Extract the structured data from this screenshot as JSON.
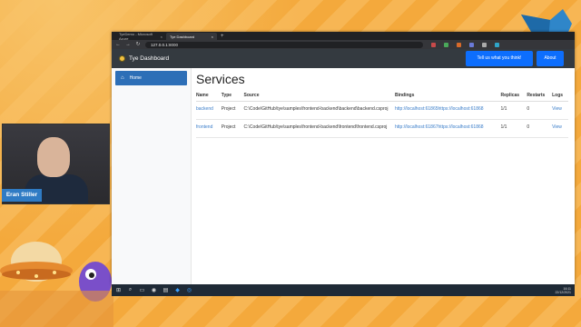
{
  "stream": {
    "presenter_name": "Eran Stiller"
  },
  "browser": {
    "tabs": [
      {
        "label": "TyeDemo - Microsoft Azure"
      },
      {
        "label": "Tye Dashboard"
      }
    ],
    "new_tab": "+",
    "address": {
      "host": "127.0.0.1",
      "port": ":8000"
    }
  },
  "app": {
    "brand": "Tye Dashboard",
    "feedback_button": "Tell us what you think!",
    "about_button": "About",
    "sidebar": [
      {
        "label": "Home"
      }
    ],
    "page_title": "Services",
    "table": {
      "headers": [
        "Name",
        "Type",
        "Source",
        "Bindings",
        "Replicas",
        "Restarts",
        "Logs"
      ],
      "rows": [
        {
          "name": "backend",
          "type": "Project",
          "source": "C:\\Code\\GitHub\\tye\\samples\\frontend-backend\\backend\\backend.csproj",
          "bindings": "http://localhost:61865https://localhost:61868",
          "replicas": "1/1",
          "restarts": "0",
          "logs": "View"
        },
        {
          "name": "frontend",
          "type": "Project",
          "source": "C:\\Code\\GitHub\\tye\\samples\\frontend-backend\\frontend\\frontend.csproj",
          "bindings": "http://localhost:61867https://localhost:61868",
          "replicas": "1/1",
          "restarts": "0",
          "logs": "View"
        }
      ]
    }
  },
  "taskbar": {
    "time": "16:11",
    "date": "22/12/2021"
  },
  "colors": {
    "header": "#343a40",
    "accent": "#0d6efd",
    "sidebar_active": "#2d6fb7",
    "link": "#3a7dc9",
    "stream_bg": "#f6b24a"
  }
}
